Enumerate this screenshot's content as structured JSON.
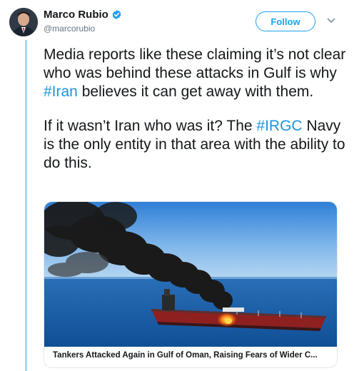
{
  "tweet": {
    "author_name": "Marco Rubio",
    "handle": "@marcorubio",
    "follow_label": "Follow",
    "paragraph1": {
      "before": "Media reports like these claiming it’s not clear who was behind these attacks in Gulf is why ",
      "hashtag": "#Iran",
      "after": " believes it can get away with them."
    },
    "paragraph2": {
      "before": "If it wasn’t Iran who was it? The ",
      "hashtag": "#IRGC",
      "after": " Navy is the only entity in that area with the ability to do this."
    }
  },
  "card": {
    "title": "Tankers Attacked Again in Gulf of Oman, Raising Fears of Wider C..."
  },
  "colors": {
    "link_blue": "#1da1f2",
    "hashtag_blue": "#1b95e0",
    "thread_line": "#a9d6f2",
    "handle_gray": "#657786"
  },
  "icons": {
    "verified": "verified-badge-icon",
    "more": "chevron-down-icon"
  }
}
